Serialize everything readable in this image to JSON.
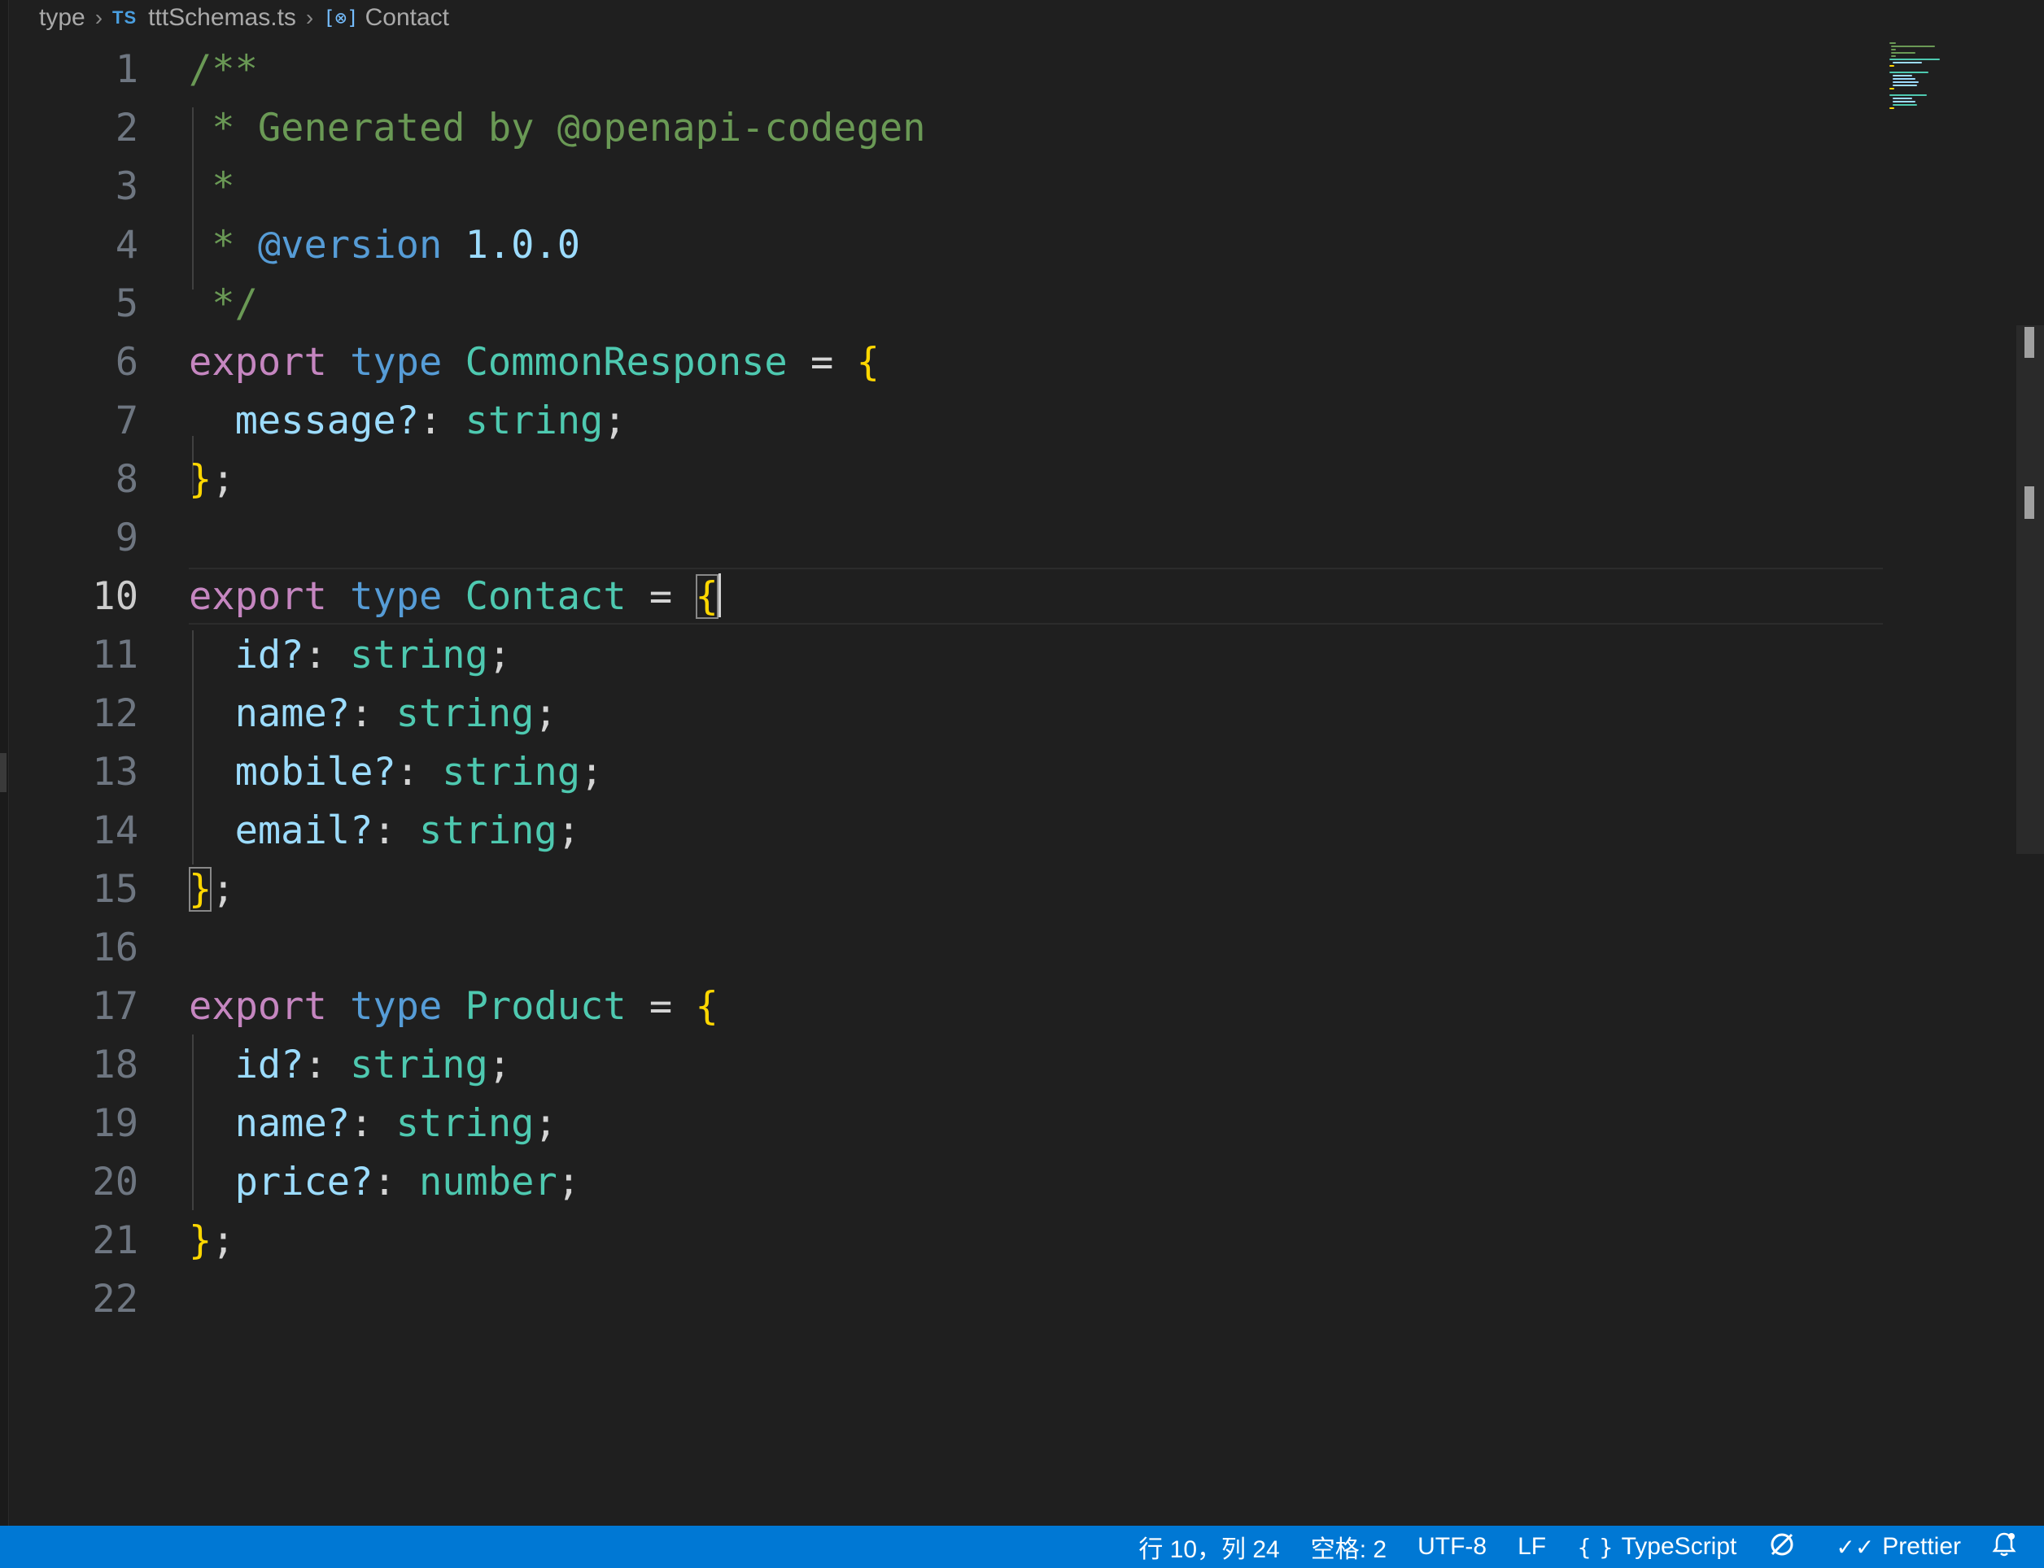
{
  "breadcrumb": {
    "folder": "type",
    "file_icon": "TS",
    "file": "tttSchemas.ts",
    "symbol": "Contact"
  },
  "editor": {
    "active_line": 10,
    "line_numbers": [
      "1",
      "2",
      "3",
      "4",
      "5",
      "6",
      "7",
      "8",
      "9",
      "10",
      "11",
      "12",
      "13",
      "14",
      "15",
      "16",
      "17",
      "18",
      "19",
      "20",
      "21",
      "22"
    ],
    "lines": {
      "l1": {
        "a": "/**"
      },
      "l2": {
        "a": " * Generated by @openapi-codegen"
      },
      "l3": {
        "a": " *"
      },
      "l4": {
        "a": " * ",
        "b": "@version",
        "c": " ",
        "d": "1.0.0"
      },
      "l5": {
        "a": " */"
      },
      "l6": {
        "a": "export",
        "b": " ",
        "c": "type",
        "d": " ",
        "e": "CommonResponse",
        "f": " = ",
        "g": "{"
      },
      "l7": {
        "a": "  message?",
        "b": ": ",
        "c": "string",
        "d": ";"
      },
      "l8": {
        "a": "}",
        "b": ";"
      },
      "l10": {
        "a": "export",
        "b": " ",
        "c": "type",
        "d": " ",
        "e": "Contact",
        "f": " = ",
        "g": "{"
      },
      "l11": {
        "a": "  id?",
        "b": ": ",
        "c": "string",
        "d": ";"
      },
      "l12": {
        "a": "  name?",
        "b": ": ",
        "c": "string",
        "d": ";"
      },
      "l13": {
        "a": "  mobile?",
        "b": ": ",
        "c": "string",
        "d": ";"
      },
      "l14": {
        "a": "  email?",
        "b": ": ",
        "c": "string",
        "d": ";"
      },
      "l15": {
        "a": "}",
        "b": ";"
      },
      "l17": {
        "a": "export",
        "b": " ",
        "c": "type",
        "d": " ",
        "e": "Product",
        "f": " = ",
        "g": "{"
      },
      "l18": {
        "a": "  id?",
        "b": ": ",
        "c": "string",
        "d": ";"
      },
      "l19": {
        "a": "  name?",
        "b": ": ",
        "c": "string",
        "d": ";"
      },
      "l20": {
        "a": "  price?",
        "b": ": ",
        "c": "number",
        "d": ";"
      },
      "l21": {
        "a": "}",
        "b": ";"
      }
    }
  },
  "statusbar": {
    "cursor_position": "行 10，列 24",
    "indentation": "空格: 2",
    "encoding": "UTF-8",
    "eol": "LF",
    "language_icon": "{ }",
    "language": "TypeScript",
    "prettier": "Prettier"
  },
  "colors": {
    "statusbar_bg": "#0078d4",
    "editor_bg": "#1f1f1f",
    "comment": "#6a9955",
    "keyword": "#c586c0",
    "type_keyword": "#569cd6",
    "type_name": "#4ec9b0",
    "property": "#9cdcfe",
    "bracket": "#ffd700"
  }
}
